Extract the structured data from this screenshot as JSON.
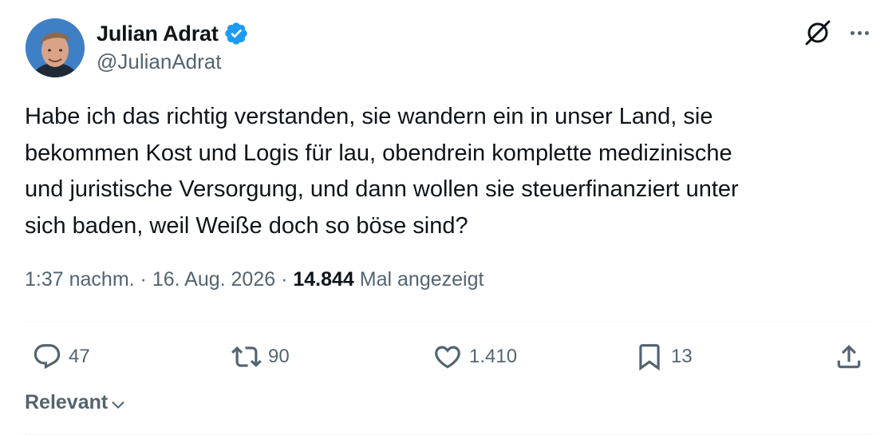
{
  "author": {
    "display_name": "Julian Adrat",
    "handle": "@JulianAdrat",
    "verified": true
  },
  "tweet": {
    "text_lines": [
      "Habe ich das richtig verstanden, sie wandern ein in unser Land, sie",
      "bekommen Kost und Logis für lau, obendrein komplette medizinische",
      "und juristische Versorgung, und dann wollen sie steuerfinanziert unter",
      "sich baden, weil Weiße doch so böse sind?"
    ],
    "time": "1:37 nachm.",
    "separator": "·",
    "date": "16. Aug. 2026",
    "views_count": "14.844",
    "views_label": "Mal angezeigt"
  },
  "actions": {
    "replies": "47",
    "reposts": "90",
    "likes": "1.410",
    "bookmarks": "13"
  },
  "replies_sort": {
    "label": "Relevant"
  },
  "colors": {
    "text_primary": "#0f1419",
    "text_secondary": "#536471",
    "verified_blue": "#1d9bf0",
    "divider": "#eff3f4"
  },
  "icons": {
    "verified": "verified-badge-icon",
    "grok": "grok-icon",
    "more": "more-icon",
    "reply": "reply-icon",
    "repost": "repost-icon",
    "like": "like-icon",
    "bookmark": "bookmark-icon",
    "share": "share-icon",
    "chevron": "chevron-down-icon"
  }
}
